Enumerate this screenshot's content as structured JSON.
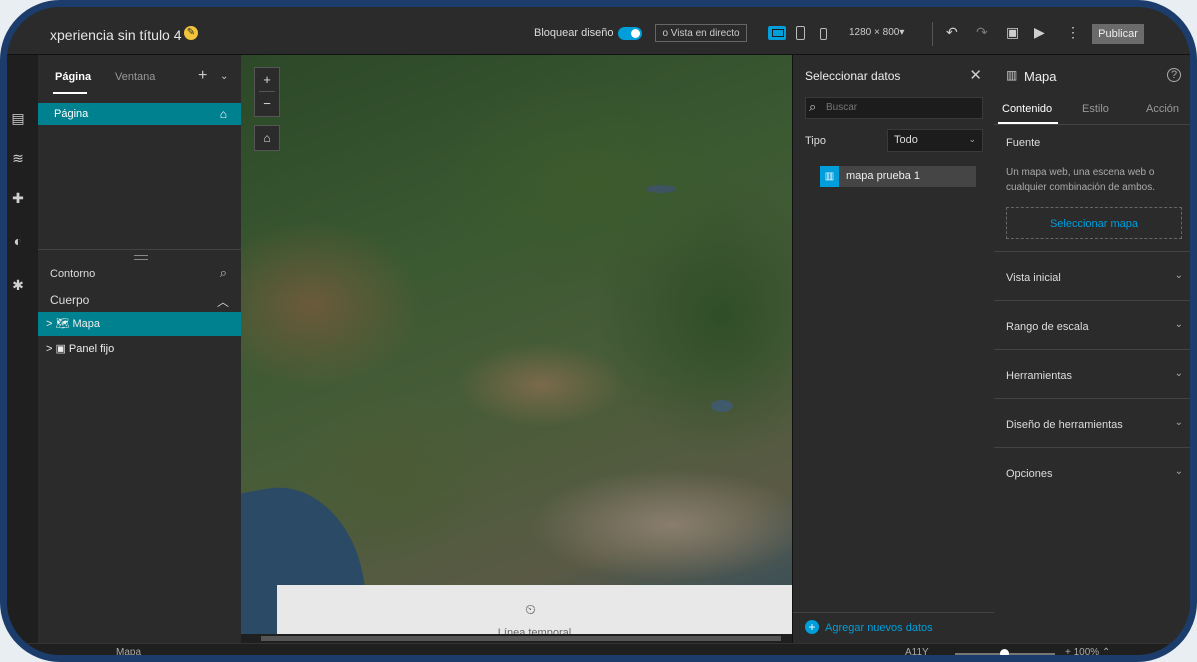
{
  "app": {
    "title": "xperiencia sin título 4",
    "lock_design_label": "Bloquear diseño",
    "lock_design_on": true,
    "live_view_label": "o Vista en directo",
    "resolution": "1280 × 800▾",
    "publish_label": "Publicar",
    "icons": [
      "pencil-icon",
      "desktop-icon",
      "tablet-icon",
      "phone-icon",
      "undo-icon",
      "redo-icon",
      "save-icon",
      "preview-icon",
      "more-icon"
    ]
  },
  "rail": {
    "icons": [
      "page-icon",
      "data-icon",
      "widget-icon",
      "theme-icon",
      "settings-icon"
    ]
  },
  "left_panel": {
    "tab_page": "Página",
    "tab_window": "Ventana",
    "page_item": "Página",
    "outline_label": "Contorno",
    "body_label": "Cuerpo",
    "tree": [
      {
        "label": "> 🗺 Mapa",
        "selected": true
      },
      {
        "label": "> ▣ Panel fijo",
        "selected": false
      }
    ]
  },
  "map": {
    "zoom_in": "+",
    "zoom_out": "−",
    "home": "⌂",
    "timeline_label": "Línea temporal"
  },
  "data_panel": {
    "title": "Seleccionar datos",
    "search_placeholder": "Buscar",
    "type_label": "Tipo",
    "type_value": "Todo",
    "items": [
      "mapa prueba 1"
    ],
    "add_label": "Agregar nuevos datos"
  },
  "properties": {
    "title": "Mapa",
    "tabs": [
      "Contenido",
      "Estilo",
      "Acción"
    ],
    "source_label": "Fuente",
    "source_desc": "Un mapa web, una escena web o cualquier combinación de ambos.",
    "select_map_label": "Seleccionar mapa",
    "sections": [
      "Vista inicial",
      "Rango de escala",
      "Herramientas",
      "Diseño de herramientas",
      "Opciones"
    ]
  },
  "status": {
    "breadcrumb": "Mapa",
    "a11y": "A11Y",
    "zoom": "+ 100% ⌃"
  },
  "colors": {
    "accent": "#009edb",
    "selection": "#00818f",
    "frame": "#1c3d6b"
  }
}
